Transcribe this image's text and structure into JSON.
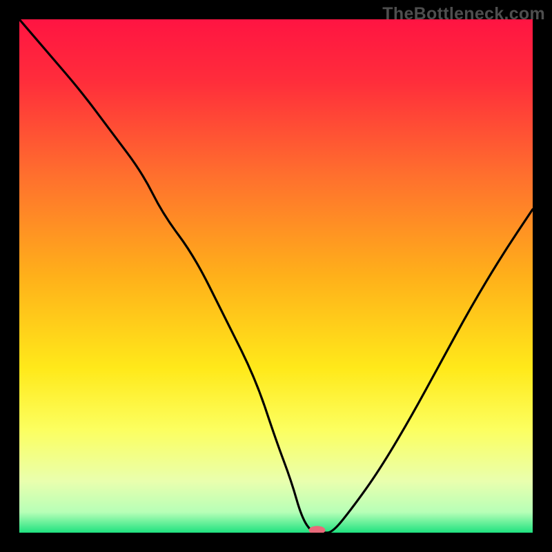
{
  "watermark": "TheBottleneck.com",
  "chart_data": {
    "type": "line",
    "title": "",
    "xlabel": "",
    "ylabel": "",
    "xlim": [
      0,
      100
    ],
    "ylim": [
      0,
      100
    ],
    "grid": false,
    "gradient_stops": [
      {
        "offset": 0.0,
        "color": "#ff1442"
      },
      {
        "offset": 0.12,
        "color": "#ff2d3b"
      },
      {
        "offset": 0.3,
        "color": "#ff6e2e"
      },
      {
        "offset": 0.5,
        "color": "#ffb01a"
      },
      {
        "offset": 0.68,
        "color": "#ffe91a"
      },
      {
        "offset": 0.8,
        "color": "#fcff60"
      },
      {
        "offset": 0.9,
        "color": "#e9ffae"
      },
      {
        "offset": 0.96,
        "color": "#b7ffb7"
      },
      {
        "offset": 1.0,
        "color": "#1fe27f"
      }
    ],
    "series": [
      {
        "name": "bottleneck-curve",
        "x": [
          0,
          6,
          12,
          18,
          24,
          28,
          34,
          40,
          46,
          50,
          53,
          55,
          57,
          59,
          61,
          65,
          70,
          76,
          82,
          88,
          94,
          100
        ],
        "y": [
          100,
          93,
          86,
          78,
          70,
          62,
          54,
          42,
          30,
          18,
          10,
          3,
          0,
          0,
          0,
          5,
          12,
          22,
          33,
          44,
          54,
          63
        ]
      }
    ],
    "marker": {
      "x": 58,
      "y": 0.5,
      "color": "#e96a7a",
      "rx": 12,
      "ry": 6
    }
  }
}
